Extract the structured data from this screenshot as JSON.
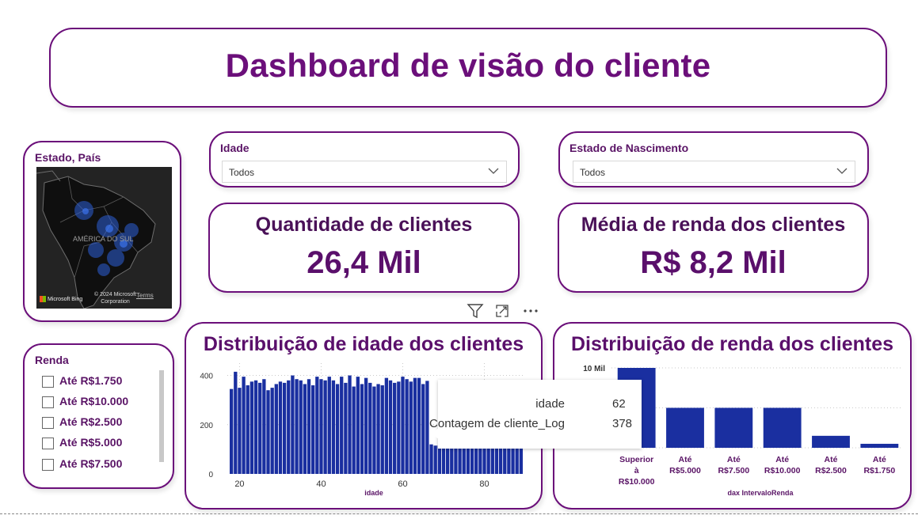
{
  "header": {
    "title": "Dashboard de visão do cliente"
  },
  "map": {
    "label": "Estado, País",
    "region_label": "AMÉRICA DO SUL",
    "attribution": "© 2024 Microsoft Corporation",
    "bing": "Microsoft Bing",
    "terms": "Terms"
  },
  "filters": {
    "idade": {
      "label": "Idade",
      "value": "Todos"
    },
    "estado": {
      "label": "Estado de Nascimento",
      "value": "Todos"
    }
  },
  "renda_slicer": {
    "label": "Renda",
    "options": [
      "Até R$1.750",
      "Até R$10.000",
      "Até R$2.500",
      "Até R$5.000",
      "Até R$7.500"
    ]
  },
  "kpis": {
    "clientes": {
      "label": "Quantidade de clientes",
      "value": "26,4 Mil"
    },
    "renda": {
      "label": "Média de renda dos clientes",
      "value": "R$ 8,2 Mil"
    }
  },
  "tooltip": {
    "rows": [
      {
        "key": "idade",
        "value": "62"
      },
      {
        "key": "Contagem de cliente_Log",
        "value": "378"
      }
    ]
  },
  "colors": {
    "accent": "#6b0f7a",
    "bar": "#1a2fa0"
  },
  "icons": [
    "filter-icon",
    "focus-mode-icon",
    "more-options-icon",
    "chevron-down-icon"
  ],
  "chart_data": [
    {
      "type": "bar",
      "title": "Distribuição de idade dos clientes",
      "xlabel": "idade",
      "ylabel": "",
      "x": [
        18,
        19,
        20,
        21,
        22,
        23,
        24,
        25,
        26,
        27,
        28,
        29,
        30,
        31,
        32,
        33,
        34,
        35,
        36,
        37,
        38,
        39,
        40,
        41,
        42,
        43,
        44,
        45,
        46,
        47,
        48,
        49,
        50,
        51,
        52,
        53,
        54,
        55,
        56,
        57,
        58,
        59,
        60,
        61,
        62,
        63,
        64,
        65,
        66,
        67,
        68,
        69,
        70,
        71,
        72,
        73,
        74,
        75,
        76,
        77,
        78,
        79,
        80,
        81,
        82,
        83,
        84,
        85,
        86,
        87,
        88,
        89
      ],
      "values": [
        345,
        415,
        350,
        395,
        360,
        375,
        380,
        370,
        385,
        340,
        350,
        365,
        375,
        370,
        380,
        400,
        385,
        380,
        365,
        385,
        360,
        395,
        385,
        380,
        395,
        380,
        365,
        395,
        370,
        400,
        355,
        395,
        365,
        390,
        370,
        355,
        365,
        360,
        390,
        380,
        370,
        375,
        395,
        385,
        375,
        390,
        390,
        365,
        378,
        120,
        115,
        115,
        115,
        115,
        115,
        115,
        115,
        115,
        115,
        115,
        115,
        115,
        115,
        115,
        115,
        115,
        115,
        115,
        115,
        115,
        115,
        115
      ],
      "xticks": [
        20,
        40,
        60,
        80
      ],
      "yticks": [
        0,
        200,
        400
      ],
      "ylim": [
        0,
        450
      ]
    },
    {
      "type": "bar",
      "title": "Distribuição de renda dos clientes",
      "xlabel": "dax IntervaloRenda",
      "ylabel": "",
      "categories": [
        "Superior à R$10.000",
        "Até R$5.000",
        "Até R$7.500",
        "Até R$10.000",
        "Até R$2.500",
        "Até R$1.750"
      ],
      "values": [
        10000,
        5000,
        5000,
        5000,
        1500,
        500
      ],
      "ytick_label": "10 Mil",
      "ylim": [
        0,
        10000
      ]
    }
  ]
}
